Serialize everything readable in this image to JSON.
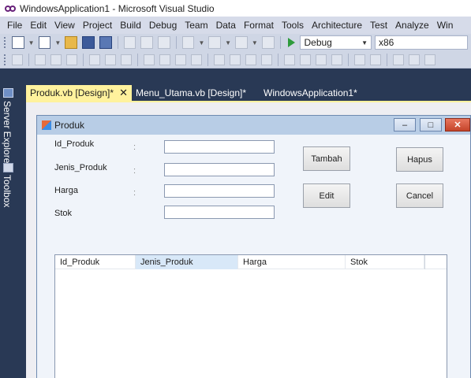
{
  "window": {
    "title": "WindowsApplication1 - Microsoft Visual Studio"
  },
  "menu": [
    "File",
    "Edit",
    "View",
    "Project",
    "Build",
    "Debug",
    "Team",
    "Data",
    "Format",
    "Tools",
    "Architecture",
    "Test",
    "Analyze",
    "Win"
  ],
  "toolbar": {
    "config": "Debug",
    "platform": "x86"
  },
  "side": {
    "server_explorer": "Server Explorer",
    "toolbox": "Toolbox"
  },
  "tabs": [
    {
      "label": "Produk.vb [Design]*",
      "close": "✕"
    },
    {
      "label": "Menu_Utama.vb [Design]*"
    },
    {
      "label": "WindowsApplication1*"
    }
  ],
  "form": {
    "title": "Produk",
    "min": "–",
    "max": "□",
    "close": "✕",
    "labels": [
      "Id_Produk",
      "Jenis_Produk",
      "Harga",
      "Stok"
    ],
    "colon": ":",
    "buttons": {
      "tambah": "Tambah",
      "hapus": "Hapus",
      "edit": "Edit",
      "cancel": "Cancel"
    },
    "list_columns": [
      "Id_Produk",
      "Jenis_Produk",
      "Harga",
      "Stok"
    ]
  }
}
